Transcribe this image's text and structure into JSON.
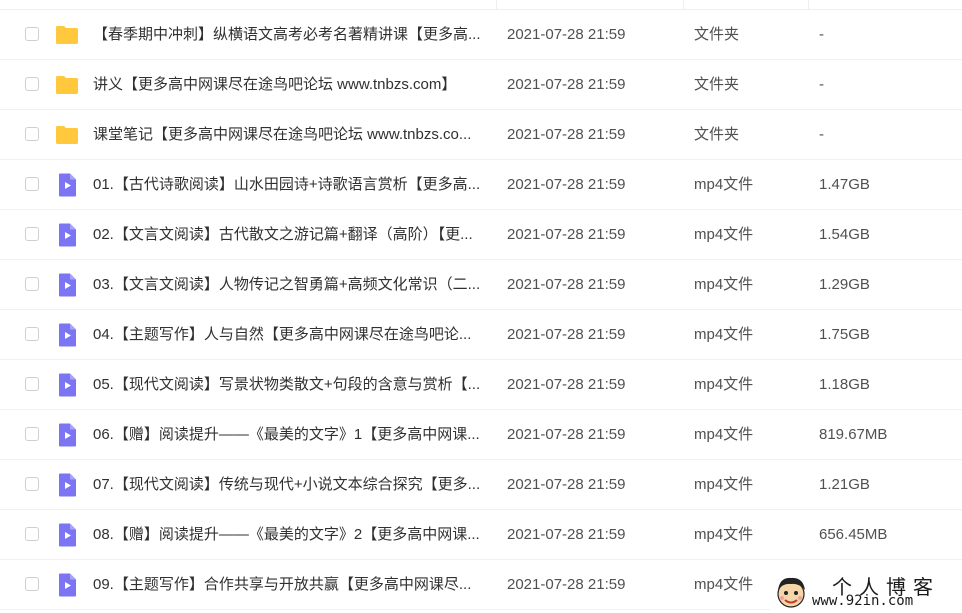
{
  "colors": {
    "folder_icon": "#FFC83D",
    "video_icon": "#7B74F3",
    "watermark_text": "#1A1A1A"
  },
  "files": [
    {
      "name": "【春季期中冲刺】纵横语文高考必考名著精讲课【更多高...",
      "date": "2021-07-28 21:59",
      "type": "文件夹",
      "size": "-",
      "icon": "folder-icon"
    },
    {
      "name": "讲义【更多高中网课尽在途鸟吧论坛 www.tnbzs.com】",
      "date": "2021-07-28 21:59",
      "type": "文件夹",
      "size": "-",
      "icon": "folder-icon"
    },
    {
      "name": "课堂笔记【更多高中网课尽在途鸟吧论坛 www.tnbzs.co...",
      "date": "2021-07-28 21:59",
      "type": "文件夹",
      "size": "-",
      "icon": "folder-icon"
    },
    {
      "name": "01.【古代诗歌阅读】山水田园诗+诗歌语言赏析【更多高...",
      "date": "2021-07-28 21:59",
      "type": "mp4文件",
      "size": "1.47GB",
      "icon": "video-file-icon"
    },
    {
      "name": "02.【文言文阅读】古代散文之游记篇+翻译（高阶）【更...",
      "date": "2021-07-28 21:59",
      "type": "mp4文件",
      "size": "1.54GB",
      "icon": "video-file-icon"
    },
    {
      "name": "03.【文言文阅读】人物传记之智勇篇+高频文化常识（二...",
      "date": "2021-07-28 21:59",
      "type": "mp4文件",
      "size": "1.29GB",
      "icon": "video-file-icon"
    },
    {
      "name": "04.【主题写作】人与自然【更多高中网课尽在途鸟吧论...",
      "date": "2021-07-28 21:59",
      "type": "mp4文件",
      "size": "1.75GB",
      "icon": "video-file-icon"
    },
    {
      "name": "05.【现代文阅读】写景状物类散文+句段的含意与赏析【...",
      "date": "2021-07-28 21:59",
      "type": "mp4文件",
      "size": "1.18GB",
      "icon": "video-file-icon"
    },
    {
      "name": "06.【赠】阅读提升——《最美的文字》1【更多高中网课...",
      "date": "2021-07-28 21:59",
      "type": "mp4文件",
      "size": "819.67MB",
      "icon": "video-file-icon"
    },
    {
      "name": "07.【现代文阅读】传统与现代+小说文本综合探究【更多...",
      "date": "2021-07-28 21:59",
      "type": "mp4文件",
      "size": "1.21GB",
      "icon": "video-file-icon"
    },
    {
      "name": "08.【赠】阅读提升——《最美的文字》2【更多高中网课...",
      "date": "2021-07-28 21:59",
      "type": "mp4文件",
      "size": "656.45MB",
      "icon": "video-file-icon"
    },
    {
      "name": "09.【主题写作】合作共享与开放共赢【更多高中网课尽...",
      "date": "2021-07-28 21:59",
      "type": "mp4文件",
      "size": "",
      "icon": "video-file-icon"
    }
  ],
  "watermark": {
    "title": "个人博客",
    "url": "www.92in.com"
  }
}
